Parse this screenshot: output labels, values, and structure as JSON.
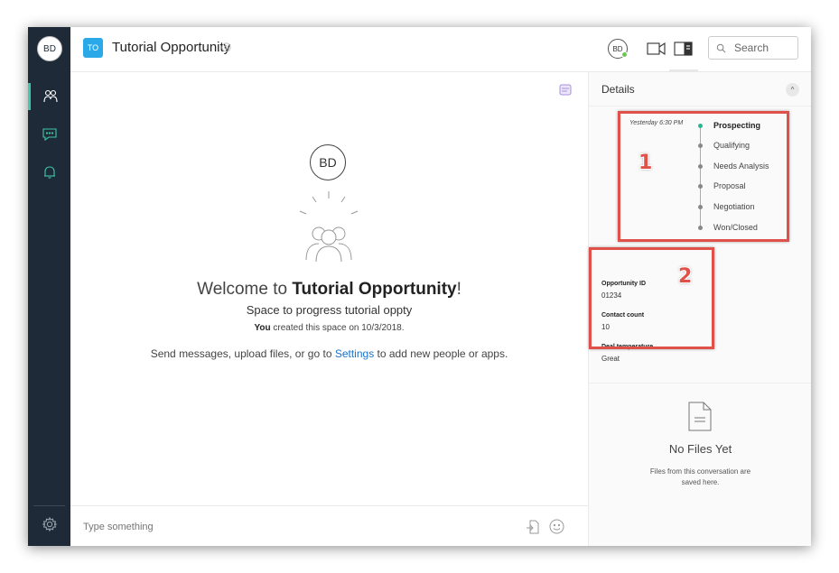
{
  "rail": {
    "avatar_initials": "BD",
    "items": [
      {
        "name": "people-icon",
        "active": true
      },
      {
        "name": "chat-icon",
        "active": false
      },
      {
        "name": "bell-icon",
        "active": false
      }
    ],
    "settings_icon": "gear-icon"
  },
  "header": {
    "space_initials": "TO",
    "title": "Tutorial Opportunity",
    "user_initials": "BD",
    "search_placeholder": "Search"
  },
  "welcome": {
    "avatar_initials": "BD",
    "prefix": "Welcome to ",
    "space_name": "Tutorial Opportunity",
    "suffix": "!",
    "description": "Space to progress tutorial oppty",
    "created_by": "You",
    "created_text": " created this space on 10/3/2018.",
    "hint_before": "Send messages, upload files, or go to ",
    "hint_link": "Settings",
    "hint_after": " to add new people or apps."
  },
  "composer": {
    "placeholder": "Type something"
  },
  "details": {
    "title": "Details",
    "timeline_time": "Yesterday 6:30 PM",
    "stages": [
      {
        "label": "Prospecting",
        "current": true
      },
      {
        "label": "Qualifying",
        "current": false
      },
      {
        "label": "Needs Analysis",
        "current": false
      },
      {
        "label": "Proposal",
        "current": false
      },
      {
        "label": "Negotiation",
        "current": false
      },
      {
        "label": "Won/Closed",
        "current": false
      }
    ],
    "fields": [
      {
        "label": "Opportunity ID",
        "value": "01234"
      },
      {
        "label": "Contact count",
        "value": "10"
      },
      {
        "label": "Deal temperature",
        "value": "Great"
      }
    ],
    "files_title": "No Files Yet",
    "files_sub": "Files from this conversation are saved here."
  },
  "annotations": {
    "one": "1",
    "two": "2",
    "color": "#e0514a"
  },
  "colors": {
    "rail": "#1e2a38",
    "accent": "#3ec7a8",
    "space_badge": "#2aa8e8",
    "link": "#1a73c8"
  }
}
